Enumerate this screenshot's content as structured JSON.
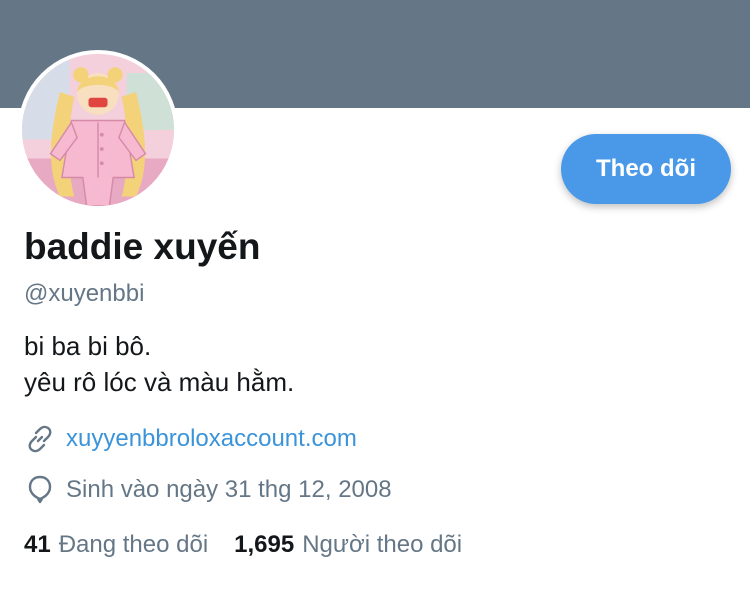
{
  "profile": {
    "display_name": "baddie xuyến",
    "handle": "@xuyenbbi",
    "bio": [
      "bi ba bi bô.",
      "yêu rô lóc và màu hằm."
    ],
    "website": "xuyyenbbroloxaccount.com",
    "birthday": "Sinh vào ngày 31 thg 12, 2008"
  },
  "actions": {
    "follow_label": "Theo dõi"
  },
  "stats": {
    "following_count": "41",
    "following_label": "Đang theo dõi",
    "followers_count": "1,695",
    "followers_label": "Người theo dõi"
  },
  "icons": {
    "avatar": "avatar-image",
    "link": "link-icon",
    "birthday": "balloon-icon"
  },
  "colors": {
    "banner": "#657786",
    "accent": "#4a99e9",
    "link": "#3b94d9",
    "muted": "#657786",
    "text": "#14171a"
  }
}
